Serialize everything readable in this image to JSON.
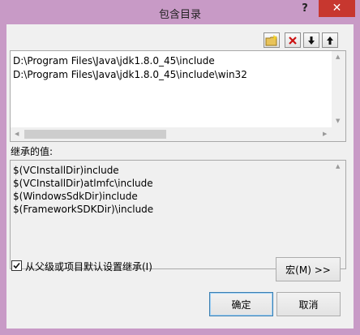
{
  "window": {
    "title": "包含目录",
    "help_label": "?",
    "close_label": "✕"
  },
  "toolbar": {
    "buttons": [
      {
        "name": "new-line",
        "icon": "new-folder-icon"
      },
      {
        "name": "delete",
        "icon": "delete-x-icon"
      },
      {
        "name": "move-down",
        "icon": "arrow-down-icon"
      },
      {
        "name": "move-up",
        "icon": "arrow-up-icon"
      }
    ]
  },
  "paths": {
    "lines": [
      "D:\\Program Files\\Java\\jdk1.8.0_45\\include",
      "D:\\Program Files\\Java\\jdk1.8.0_45\\include\\win32"
    ]
  },
  "inherited": {
    "label": "继承的值:",
    "lines": [
      "$(VCInstallDir)include",
      "$(VCInstallDir)atlmfc\\include",
      "$(WindowsSdkDir)include",
      "$(FrameworkSDKDir)\\include"
    ]
  },
  "options": {
    "inherit_checkbox_label": "从父级或项目默认设置继承(I)",
    "inherit_checked": true
  },
  "buttons": {
    "macro": "宏(M) >>",
    "ok": "确定",
    "cancel": "取消"
  },
  "colors": {
    "titlebar": "#c89ac6",
    "close": "#c7372f",
    "delete_icon": "#cc1111"
  }
}
